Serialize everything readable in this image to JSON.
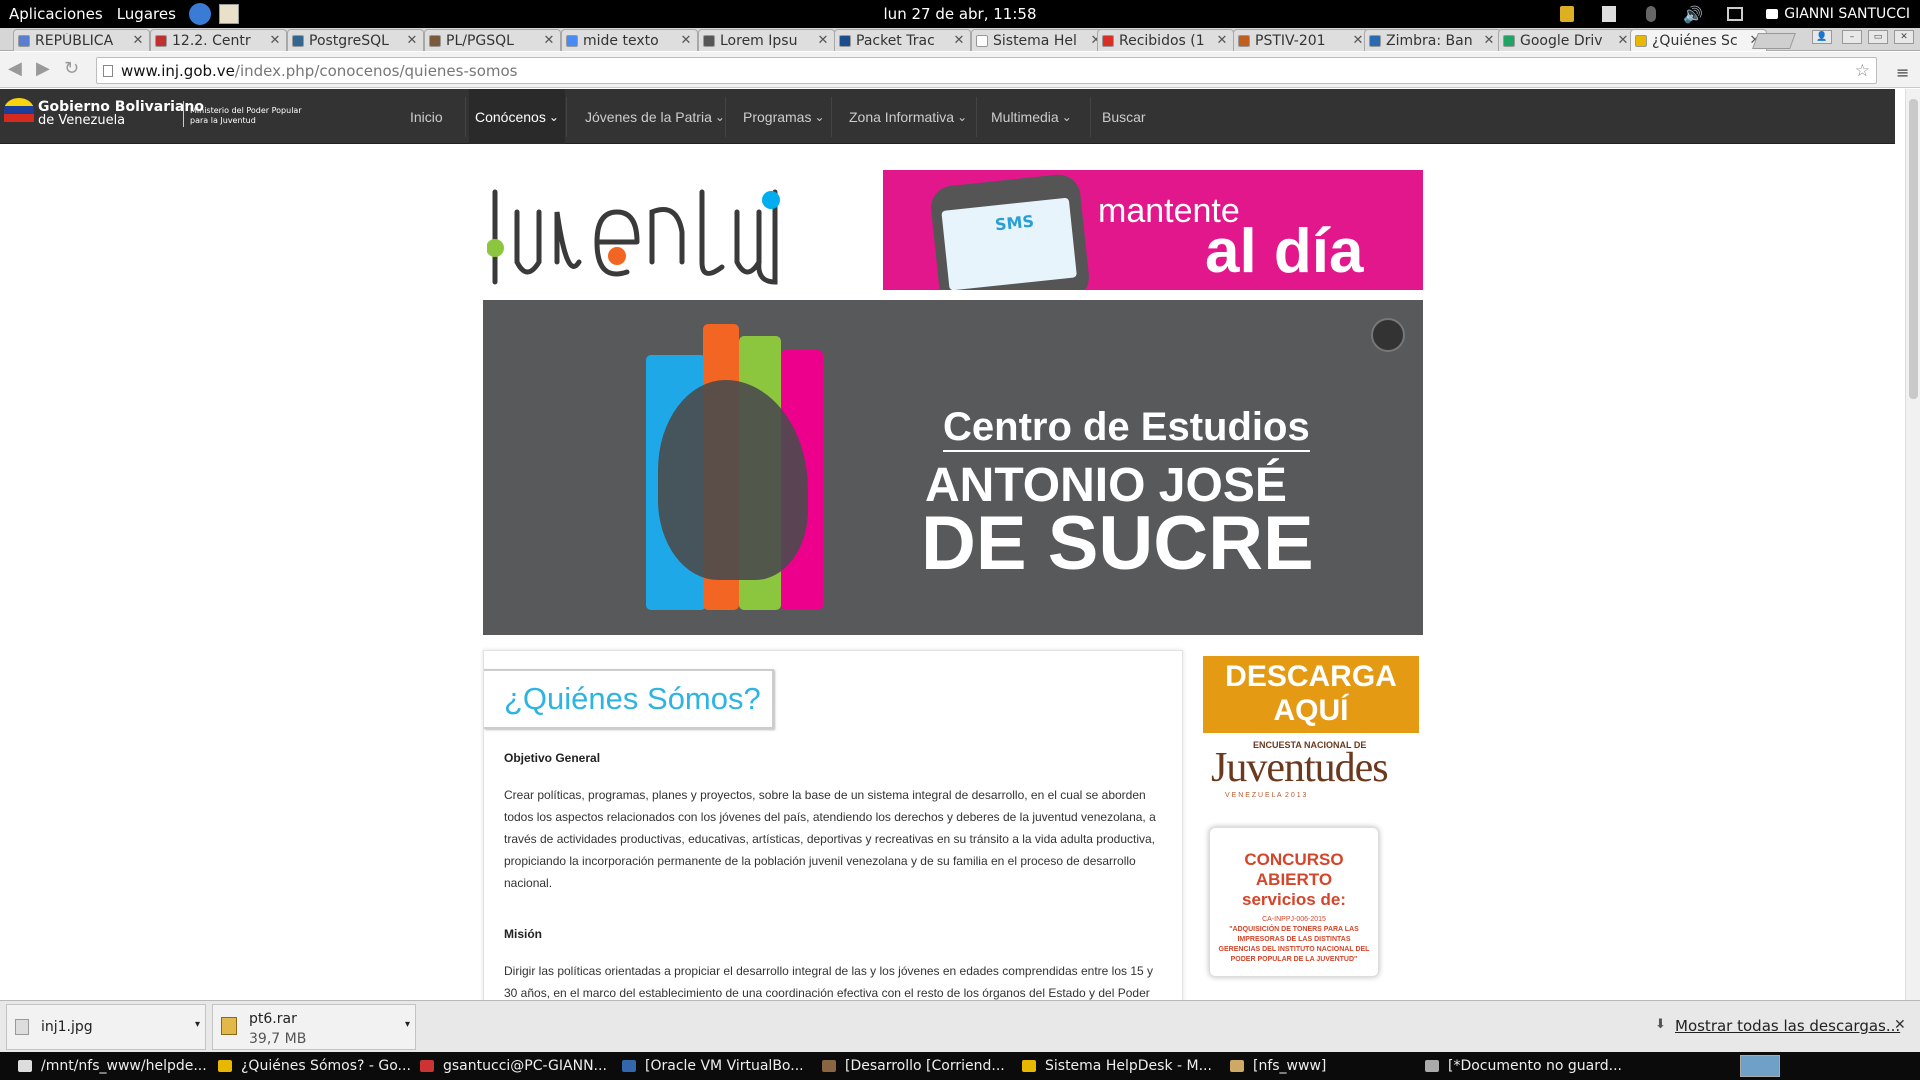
{
  "topbar": {
    "apps_label": "Aplicaciones",
    "places_label": "Lugares",
    "clock": "lun 27 de abr, 11:58",
    "user": "GIANNI SANTUCCI"
  },
  "tabs": [
    {
      "label": "REPÚBLICA",
      "favicon_color": "#5a7fd0"
    },
    {
      "label": "12.2. Centr",
      "favicon_color": "#c03030"
    },
    {
      "label": "PostgreSQL",
      "favicon_color": "#336791"
    },
    {
      "label": "PL/PGSQL",
      "favicon_color": "#7a5a3a"
    },
    {
      "label": "mide texto",
      "favicon_color": "#4a8af4"
    },
    {
      "label": "Lorem Ipsu",
      "favicon_color": "#555555"
    },
    {
      "label": "Packet Trac",
      "favicon_color": "#1a4d8c"
    },
    {
      "label": "Sistema Hel",
      "favicon_color": "#ffffff"
    },
    {
      "label": "Recibidos (1",
      "favicon_color": "#d93025"
    },
    {
      "label": "PSTIV-201",
      "favicon_color": "#c06020"
    },
    {
      "label": "Zimbra: Ban",
      "favicon_color": "#2a6ab0"
    },
    {
      "label": "Google Driv",
      "favicon_color": "#1fa463"
    },
    {
      "label": "¿Quiénes Sc",
      "favicon_color": "#e8b800",
      "active": true
    }
  ],
  "address": {
    "domain": "www.inj.gob.ve",
    "path": "/index.php/conocenos/quienes-somos"
  },
  "site": {
    "logo_line1": "Gobierno Bolivariano",
    "logo_line2": "de Venezuela",
    "logo_ministry1": "Ministerio del Poder Popular",
    "logo_ministry2": "para la Juventud",
    "nav": [
      "Inicio",
      "Conócenos",
      "Jóvenes de la Patria",
      "Programas",
      "Zona Informativa",
      "Multimedia",
      "Buscar"
    ],
    "banner_line1": "mantente",
    "banner_line2": "al día",
    "banner_sms": "SMS",
    "hero_line1": "Centro de Estudios",
    "hero_line2": "ANTONIO JOSÉ",
    "hero_line3": "DE SUCRE"
  },
  "article": {
    "title": "¿Quiénes Sómos?",
    "section1": "Objetivo General",
    "text1": "Crear políticas, programas, planes y proyectos, sobre la base de un sistema integral de desarrollo, en el cual se aborden todos los aspectos relacionados con los jóvenes del país, atendiendo los derechos y deberes de la juventud venezolana, a través de actividades productivas, educativas, artísticas, deportivas y recreativas en su tránsito a la vida adulta productiva, propiciando la incorporación permanente de la población juvenil venezolana y de su familia en el proceso de desarrollo nacional.",
    "section2": "Misión",
    "text2": "Dirigir las políticas orientadas a propiciar el desarrollo integral de las y los jóvenes en edades comprendidas entre los 15 y 30 años, en el marco del establecimiento de una coordinación efectiva con el resto de los órganos del Estado y del Poder"
  },
  "sidebar": {
    "descarga_line1": "DESCARGA",
    "descarga_line2": "AQUÍ",
    "encuesta": "ENCUESTA NACIONAL DE",
    "juventudes": "Juventudes",
    "venezuela": "V E N E Z U E L A  2 0 1 3",
    "concurso1": "CONCURSO ABIERTO",
    "concurso2": "servicios de:",
    "concurso_code": "CA-INPPJ-006-2015",
    "concurso_desc": "\"ADQUISICIÓN DE TONERS PARA LAS IMPRESORAS DE LAS DISTINTAS GERENCIAS DEL INSTITUTO NACIONAL DEL PODER POPULAR DE LA JUVENTUD\""
  },
  "downloads": {
    "items": [
      {
        "name": "inj1.jpg",
        "size": ""
      },
      {
        "name": "pt6.rar",
        "size": "39,7 MB"
      }
    ],
    "show_all": "Mostrar todas las descargas..."
  },
  "taskbar": [
    {
      "label": "/mnt/nfs_www/helpde...",
      "icon_color": "#dddddd"
    },
    {
      "label": "¿Quiénes Sómos? - Go...",
      "icon_color": "#e8b800"
    },
    {
      "label": "gsantucci@PC-GIANN...",
      "icon_color": "#cc3333"
    },
    {
      "label": "[Oracle VM VirtualBo...",
      "icon_color": "#3366aa"
    },
    {
      "label": "[Desarrollo [Corriend...",
      "icon_color": "#886644"
    },
    {
      "label": "Sistema HelpDesk - M...",
      "icon_color": "#e8b800"
    },
    {
      "label": "[nfs_www]",
      "icon_color": "#ccaa66"
    },
    {
      "label": "[*Documento no guard...",
      "icon_color": "#aaaaaa"
    }
  ]
}
